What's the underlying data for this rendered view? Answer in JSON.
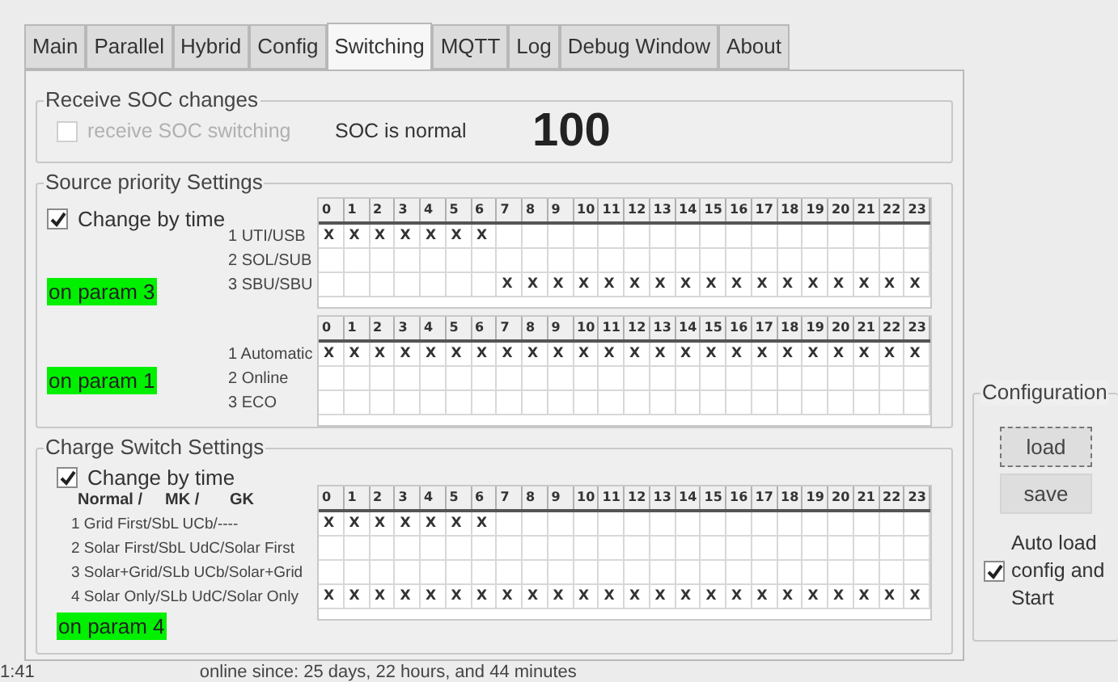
{
  "tabs": [
    {
      "label": "Main",
      "selected": false
    },
    {
      "label": "Parallel",
      "selected": false
    },
    {
      "label": "Hybrid",
      "selected": false
    },
    {
      "label": "Config",
      "selected": false
    },
    {
      "label": "Switching",
      "selected": true
    },
    {
      "label": "MQTT",
      "selected": false
    },
    {
      "label": "Log",
      "selected": false
    },
    {
      "label": "Debug Window",
      "selected": false
    },
    {
      "label": "About",
      "selected": false
    }
  ],
  "soc": {
    "title": "Receive SOC changes",
    "checkbox": {
      "label": "receive SOC switching",
      "checked": false,
      "disabled": true
    },
    "status": "SOC is normal",
    "value": "100"
  },
  "source_priority": {
    "title": "Source priority Settings",
    "change_by_time": {
      "label": "Change by time",
      "checked": true
    },
    "tables": [
      {
        "status": "on param 3",
        "hours": [
          "0",
          "1",
          "2",
          "3",
          "4",
          "5",
          "6",
          "7",
          "8",
          "9",
          "10",
          "11",
          "12",
          "13",
          "14",
          "15",
          "16",
          "17",
          "18",
          "19",
          "20",
          "21",
          "22",
          "23"
        ],
        "rows": [
          {
            "label": "1 UTI/USB",
            "cells": [
              "X",
              "X",
              "X",
              "X",
              "X",
              "X",
              "X",
              null,
              null,
              null,
              null,
              null,
              null,
              null,
              null,
              null,
              null,
              null,
              null,
              null,
              null,
              null,
              null,
              null
            ]
          },
          {
            "label": "2 SOL/SUB",
            "cells": [
              null,
              null,
              null,
              null,
              null,
              null,
              null,
              null,
              null,
              null,
              null,
              null,
              null,
              null,
              null,
              null,
              null,
              null,
              null,
              null,
              null,
              null,
              null,
              null
            ]
          },
          {
            "label": "3 SBU/SBU",
            "cells": [
              null,
              null,
              null,
              null,
              null,
              null,
              null,
              "X",
              "X",
              "X",
              "X",
              "X",
              "X",
              "X",
              "X",
              "X",
              "X",
              "X",
              "X",
              "X",
              "X",
              "X",
              "X",
              "X"
            ]
          }
        ]
      },
      {
        "status": "on param 1",
        "hours": [
          "0",
          "1",
          "2",
          "3",
          "4",
          "5",
          "6",
          "7",
          "8",
          "9",
          "10",
          "11",
          "12",
          "13",
          "14",
          "15",
          "16",
          "17",
          "18",
          "19",
          "20",
          "21",
          "22",
          "23"
        ],
        "rows": [
          {
            "label": "1 Automatic",
            "cells": [
              "X",
              "X",
              "X",
              "X",
              "X",
              "X",
              "X",
              "X",
              "X",
              "X",
              "X",
              "X",
              "X",
              "X",
              "X",
              "X",
              "X",
              "X",
              "X",
              "X",
              "X",
              "X",
              "X",
              "X"
            ]
          },
          {
            "label": "2 Online",
            "cells": [
              null,
              null,
              null,
              null,
              null,
              null,
              null,
              null,
              null,
              null,
              null,
              null,
              null,
              null,
              null,
              null,
              null,
              null,
              null,
              null,
              null,
              null,
              null,
              null
            ]
          },
          {
            "label": "3 ECO",
            "cells": [
              null,
              null,
              null,
              null,
              null,
              null,
              null,
              null,
              null,
              null,
              null,
              null,
              null,
              null,
              null,
              null,
              null,
              null,
              null,
              null,
              null,
              null,
              null,
              null
            ]
          }
        ]
      }
    ]
  },
  "charge_switch": {
    "title": "Charge Switch Settings",
    "change_by_time": {
      "label": "Change by time",
      "checked": true
    },
    "headers": [
      "Normal /",
      "MK /",
      "GK"
    ],
    "status": "on param 4",
    "table": {
      "hours": [
        "0",
        "1",
        "2",
        "3",
        "4",
        "5",
        "6",
        "7",
        "8",
        "9",
        "10",
        "11",
        "12",
        "13",
        "14",
        "15",
        "16",
        "17",
        "18",
        "19",
        "20",
        "21",
        "22",
        "23"
      ],
      "rows": [
        {
          "label": "1 Grid First/SbL UCb/----",
          "cells": [
            "X",
            "X",
            "X",
            "X",
            "X",
            "X",
            "X",
            null,
            null,
            null,
            null,
            null,
            null,
            null,
            null,
            null,
            null,
            null,
            null,
            null,
            null,
            null,
            null,
            null
          ]
        },
        {
          "label": "2 Solar First/SbL UdC/Solar First",
          "cells": [
            null,
            null,
            null,
            null,
            null,
            null,
            null,
            null,
            null,
            null,
            null,
            null,
            null,
            null,
            null,
            null,
            null,
            null,
            null,
            null,
            null,
            null,
            null,
            null
          ]
        },
        {
          "label": "3 Solar+Grid/SLb UCb/Solar+Grid",
          "cells": [
            null,
            null,
            null,
            null,
            null,
            null,
            null,
            null,
            null,
            null,
            null,
            null,
            null,
            null,
            null,
            null,
            null,
            null,
            null,
            null,
            null,
            null,
            null,
            null
          ]
        },
        {
          "label": "4 Solar Only/SLb UdC/Solar Only",
          "cells": [
            "X",
            "X",
            "X",
            "X",
            "X",
            "X",
            "X",
            "X",
            "X",
            "X",
            "X",
            "X",
            "X",
            "X",
            "X",
            "X",
            "X",
            "X",
            "X",
            "X",
            "X",
            "X",
            "X",
            "X"
          ]
        }
      ]
    }
  },
  "configuration": {
    "title": "Configuration",
    "buttons": [
      {
        "label": "load",
        "focused": true
      },
      {
        "label": "save",
        "focused": false
      }
    ],
    "auto_load": {
      "label": "Auto load config and Start",
      "checked": true
    }
  },
  "status_bar": {
    "time": "1:41",
    "online": "online since: 25 days, 22 hours, and 44 minutes"
  }
}
